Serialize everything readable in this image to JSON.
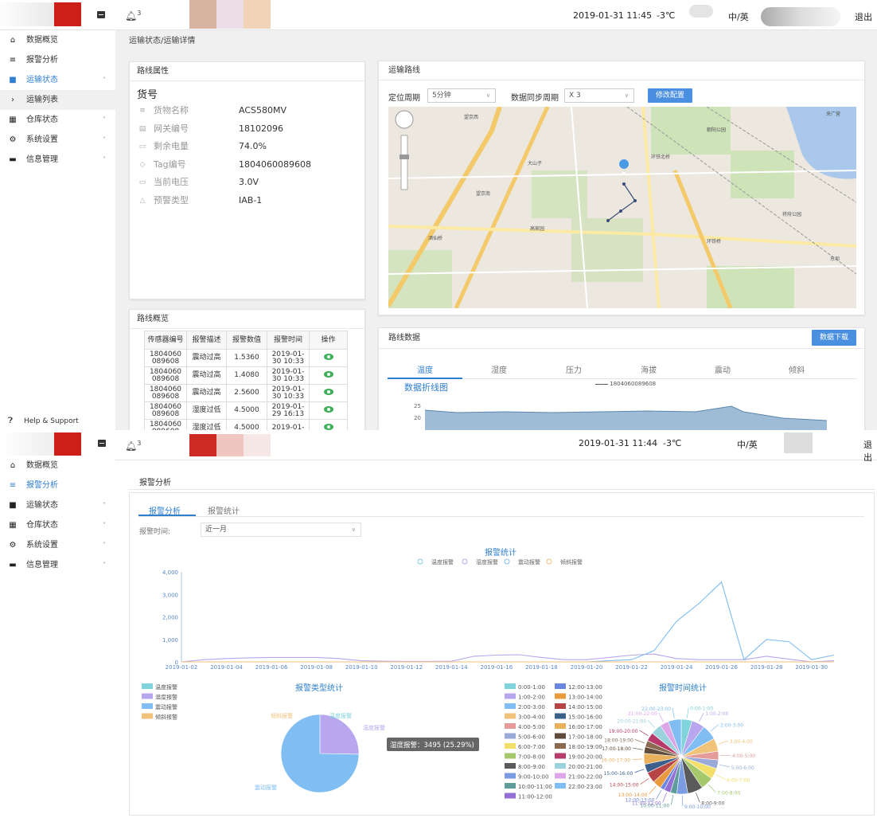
{
  "screen1": {
    "header": {
      "notifications": "3",
      "datetime": "2019-01-31 11:45",
      "temperature": "-3℃",
      "language": "中/英",
      "logout": "退出"
    },
    "sidebar": [
      {
        "label": "数据概览",
        "icon": "home-icon"
      },
      {
        "label": "报警分析",
        "icon": "list-icon"
      },
      {
        "label": "运输状态",
        "icon": "truck-icon",
        "active": true,
        "caret": "˄"
      },
      {
        "label": "运输列表",
        "icon": "chevron-right-icon",
        "sub": true
      },
      {
        "label": "仓库状态",
        "icon": "warehouse-icon",
        "caret": "˅"
      },
      {
        "label": "系统设置",
        "icon": "gear-icon",
        "caret": "˅"
      },
      {
        "label": "信息管理",
        "icon": "info-icon",
        "caret": "˅"
      }
    ],
    "help": "Help & Support",
    "breadcrumb": "运输状态/运输详情",
    "route_attrs": {
      "title": "路线属性",
      "heading": "货号",
      "rows": [
        {
          "key": "货物名称",
          "value": "ACS580MV"
        },
        {
          "key": "网关编号",
          "value": "18102096"
        },
        {
          "key": "剩余电量",
          "value": "74.0%"
        },
        {
          "key": "Tag编号",
          "value": "1804060089608"
        },
        {
          "key": "当前电压",
          "value": "3.0V"
        },
        {
          "key": "预警类型",
          "value": "IAB-1"
        }
      ]
    },
    "route_overview": {
      "title": "路线概览",
      "columns": [
        "传感器编号",
        "报警描述",
        "报警数值",
        "报警时间",
        "操作"
      ],
      "rows": [
        [
          "1804060\n089608",
          "震动过高",
          "1.5360",
          "2019-01-\n30 10:33"
        ],
        [
          "1804060\n089608",
          "震动过高",
          "1.4080",
          "2019-01-\n30 10:33"
        ],
        [
          "1804060\n089608",
          "震动过高",
          "2.5600",
          "2019-01-\n30 10:33"
        ],
        [
          "1804060\n089608",
          "湿度过低",
          "4.5000",
          "2019-01-\n29 16:13"
        ],
        [
          "1804060\n089608",
          "湿度过低",
          "4.5000",
          "2019-01-"
        ]
      ]
    },
    "route_map": {
      "title": "运输路线",
      "locate_label": "定位周期",
      "locate_value": "5分钟",
      "sync_label": "数据同步周期",
      "sync_value": "X 3",
      "modify_button": "修改配置",
      "labels": [
        "望京西",
        "环铁北桥",
        "环铁桥",
        "望京南",
        "将府公园",
        "大山子",
        "高家园",
        "酒仙桥",
        "朝阳公园",
        "东坝",
        "来广营"
      ]
    },
    "route_data": {
      "title": "路线数据",
      "download_button": "数据下载",
      "tabs": [
        "温度",
        "湿度",
        "压力",
        "海拔",
        "震动",
        "倾斜"
      ],
      "chart_title": "数据折线图",
      "legend": "1804060089608",
      "y_ticks": [
        "25",
        "20"
      ]
    }
  },
  "screen2": {
    "header": {
      "notifications": "3",
      "datetime": "2019-01-31 11:44",
      "temperature": "-3℃",
      "language": "中/英",
      "logout": "退出"
    },
    "sidebar": [
      {
        "label": "数据概览",
        "icon": "home-icon"
      },
      {
        "label": "报警分析",
        "icon": "list-icon",
        "active": true
      },
      {
        "label": "运输状态",
        "icon": "truck-icon",
        "caret": "˅"
      },
      {
        "label": "仓库状态",
        "icon": "warehouse-icon",
        "caret": "˅"
      },
      {
        "label": "系统设置",
        "icon": "gear-icon",
        "caret": "˅"
      },
      {
        "label": "信息管理",
        "icon": "info-icon",
        "caret": "˅"
      }
    ],
    "page_title": "报警分析",
    "subtabs": [
      "报警分析",
      "报警统计"
    ],
    "time_label": "报警时间:",
    "time_value": "近一月"
  },
  "chart_data": [
    {
      "type": "line",
      "title": "报警统计",
      "legend_placement": "top",
      "x": [
        "2019-01-02",
        "2019-01-03",
        "2019-01-04",
        "2019-01-05",
        "2019-01-06",
        "2019-01-07",
        "2019-01-08",
        "2019-01-09",
        "2019-01-10",
        "2019-01-11",
        "2019-01-12",
        "2019-01-13",
        "2019-01-14",
        "2019-01-15",
        "2019-01-16",
        "2019-01-17",
        "2019-01-18",
        "2019-01-19",
        "2019-01-20",
        "2019-01-21",
        "2019-01-22",
        "2019-01-23",
        "2019-01-24",
        "2019-01-25",
        "2019-01-26",
        "2019-01-27",
        "2019-01-28",
        "2019-01-29",
        "2019-01-30",
        "2019-01-31"
      ],
      "x_tick_labels": [
        "2019-01-02",
        "2019-01-04",
        "2019-01-06",
        "2019-01-08",
        "2019-01-10",
        "2019-01-12",
        "2019-01-14",
        "2019-01-16",
        "2019-01-18",
        "2019-01-20",
        "2019-01-22",
        "2019-01-24",
        "2019-01-26",
        "2019-01-28",
        "2019-01-30"
      ],
      "y_ticks": [
        "4,000",
        "3,000",
        "2,000",
        "1,000",
        "0"
      ],
      "ylim": [
        0,
        4000
      ],
      "grid": false,
      "series": [
        {
          "name": "温度报警",
          "color": "#7fd3da",
          "values": [
            0,
            0,
            0,
            0,
            0,
            0,
            0,
            0,
            0,
            0,
            0,
            0,
            0,
            0,
            0,
            0,
            0,
            0,
            0,
            0,
            0,
            0,
            0,
            0,
            0,
            0,
            0,
            0,
            0,
            0
          ]
        },
        {
          "name": "湿度报警",
          "color": "#b8a6ee",
          "values": [
            0,
            100,
            150,
            180,
            200,
            200,
            200,
            150,
            50,
            30,
            20,
            20,
            30,
            250,
            300,
            320,
            200,
            100,
            100,
            200,
            300,
            350,
            150,
            100,
            100,
            100,
            250,
            120,
            0,
            50
          ]
        },
        {
          "name": "震动报警",
          "color": "#7fbdf2",
          "values": [
            0,
            0,
            0,
            0,
            0,
            0,
            0,
            0,
            0,
            0,
            0,
            0,
            0,
            0,
            0,
            0,
            0,
            0,
            0,
            50,
            100,
            500,
            1800,
            2600,
            3550,
            100,
            1000,
            900,
            100,
            300
          ]
        },
        {
          "name": "倾斜报警",
          "color": "#f0c27a",
          "values": [
            0,
            0,
            0,
            0,
            0,
            0,
            0,
            0,
            0,
            0,
            0,
            0,
            0,
            0,
            0,
            0,
            0,
            0,
            0,
            0,
            0,
            0,
            0,
            0,
            0,
            0,
            0,
            0,
            0,
            0
          ]
        }
      ]
    },
    {
      "type": "pie",
      "title": "报警类型统计",
      "legend": [
        "温度报警",
        "湿度报警",
        "震动报警",
        "倾斜报警"
      ],
      "slice_labels": [
        "倾斜报警",
        "温度报警",
        "湿度报警",
        "震动报警"
      ],
      "values": [
        0,
        2,
        3495,
        10330
      ],
      "colors": [
        "#f0c27a",
        "#7fd3da",
        "#b8a6ee",
        "#7fbdf2"
      ],
      "tooltip": "湿度报警：3495 (25.29%)"
    },
    {
      "type": "pie",
      "title": "报警时间统计",
      "legend": [
        "0:00-1:00",
        "1:00-2:00",
        "2:00-3:00",
        "3:00-4:00",
        "4:00-5:00",
        "5:00-6:00",
        "6:00-7:00",
        "7:00-8:00",
        "8:00-9:00",
        "9:00-10:00",
        "10:00-11:00",
        "11:00-12:00",
        "12:00-13:00",
        "13:00-14:00",
        "14:00-15:00",
        "15:00-16:00",
        "16:00-17:00",
        "17:00-18:00",
        "18:00-19:00",
        "19:00-20:00",
        "20:00-21:00",
        "21:00-22:00",
        "22:00-23:00"
      ],
      "values": [
        5,
        6,
        7,
        6,
        4,
        4,
        5,
        6,
        7,
        5,
        3,
        3,
        2,
        4,
        5,
        4,
        5,
        3,
        3,
        4,
        5,
        4,
        6
      ],
      "colors": [
        "#7fd3da",
        "#b8a6ee",
        "#7fbdf2",
        "#f0c27a",
        "#e69b9b",
        "#9aa9d8",
        "#f2e06a",
        "#a5c96a",
        "#5a5a5a",
        "#7b9be3",
        "#5f9c9c",
        "#9470d6",
        "#6b86e0",
        "#e89a3c",
        "#b84545",
        "#3d5f8c",
        "#e9b15d",
        "#5e4b3a",
        "#8a6a50",
        "#b83a6b",
        "#9ad2de",
        "#dca6e8",
        "#7fbdf2"
      ]
    }
  ]
}
